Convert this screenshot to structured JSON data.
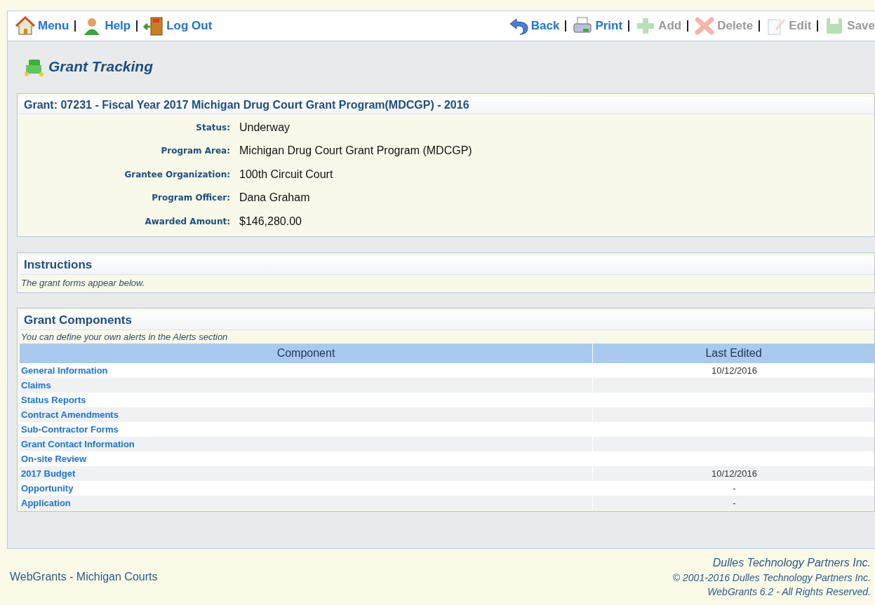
{
  "toolbar": {
    "left": [
      {
        "label": "Menu",
        "disabled": false
      },
      {
        "label": "Help",
        "disabled": false
      },
      {
        "label": "Log Out",
        "disabled": false
      }
    ],
    "right": [
      {
        "label": "Back",
        "disabled": false
      },
      {
        "label": "Print",
        "disabled": false
      },
      {
        "label": "Add",
        "disabled": true
      },
      {
        "label": "Delete",
        "disabled": true
      },
      {
        "label": "Edit",
        "disabled": true
      },
      {
        "label": "Save",
        "disabled": true
      }
    ]
  },
  "page_title": "Grant Tracking",
  "grant": {
    "title": "Grant: 07231 - Fiscal Year 2017 Michigan Drug Court Grant Program(MDCGP) - 2016",
    "fields": [
      {
        "label": "Status:",
        "value": "Underway"
      },
      {
        "label": "Program Area:",
        "value": "Michigan Drug Court Grant Program (MDCGP)"
      },
      {
        "label": "Grantee Organization:",
        "value": "100th Circuit Court"
      },
      {
        "label": "Program Officer:",
        "value": "Dana Graham"
      },
      {
        "label": "Awarded Amount:",
        "value": "$146,280.00"
      }
    ]
  },
  "instructions": {
    "title": "Instructions",
    "text": "The grant forms appear below."
  },
  "components": {
    "title": "Grant Components",
    "note": "You can define your own alerts in the Alerts section",
    "columns": [
      "Component",
      "Last Edited"
    ],
    "rows": [
      {
        "name": "General Information",
        "last_edited": "10/12/2016"
      },
      {
        "name": "Claims"
      },
      {
        "name": "Status Reports"
      },
      {
        "name": "Contract Amendments"
      },
      {
        "name": "Sub-Contractor Forms"
      },
      {
        "name": "Grant Contact Information"
      },
      {
        "name": "On-site Review"
      },
      {
        "name": "2017 Budget",
        "last_edited": "10/12/2016"
      },
      {
        "name": "Opportunity",
        "last_edited": "-"
      },
      {
        "name": "Application",
        "last_edited": "-"
      }
    ]
  },
  "footer": {
    "left": "WebGrants - Michigan Courts",
    "right": [
      "Dulles Technology Partners Inc.",
      "© 2001-2016 Dulles Technology Partners Inc.",
      "WebGrants 6.2 - All Rights Reserved."
    ]
  }
}
